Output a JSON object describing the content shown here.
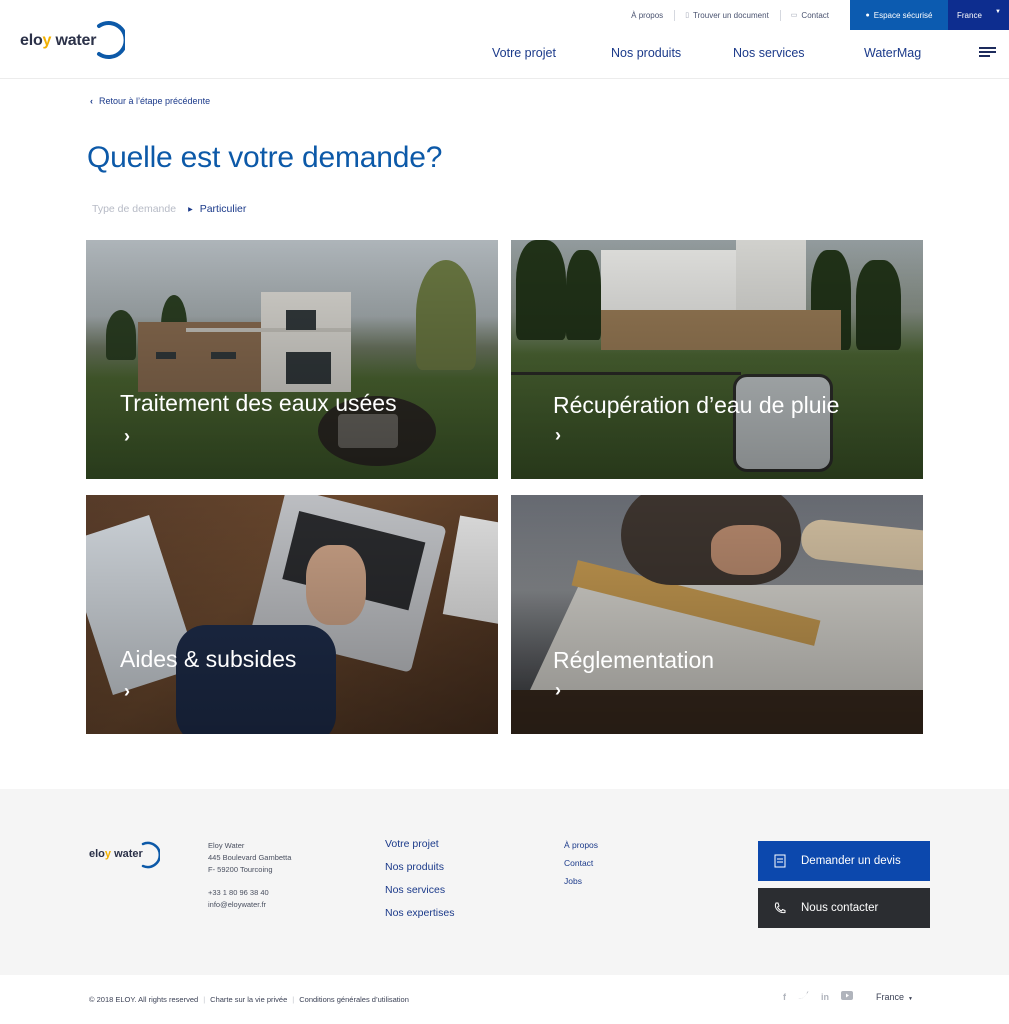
{
  "brand": {
    "name_part1": "elo",
    "name_accent": "y",
    "name_part2": " water",
    "accent_color": "#f2b000",
    "primary_color": "#0c59a8",
    "dark_blue": "#0d2d8f"
  },
  "topbar": {
    "about": "À propos",
    "find_document": "Trouver un document",
    "contact": "Contact",
    "secure_space": "Espace sécurisé",
    "language": "France"
  },
  "nav": {
    "items": [
      "Votre projet",
      "Nos produits",
      "Nos services",
      "WaterMag"
    ],
    "menu_icon": "hamburger-icon"
  },
  "back_link": "Retour à l’étape précédente",
  "page_title": "Quelle est votre demande?",
  "breadcrumb": {
    "step1": "Type de demande",
    "step2": "Particulier"
  },
  "tiles": [
    {
      "label": "Traitement des eaux usées"
    },
    {
      "label": "Récupération d’eau de pluie"
    },
    {
      "label": "Aides & subsides"
    },
    {
      "label": "Réglementation"
    }
  ],
  "footer": {
    "address": {
      "company": "Eloy Water",
      "street": "445 Boulevard Gambetta",
      "city": "F- 59200 Tourcoing",
      "phone": "+33 1 80 96 38 40",
      "email": "info@eloywater.fr"
    },
    "col1": [
      "Votre projet",
      "Nos produits",
      "Nos services",
      "Nos expertises"
    ],
    "col2": [
      "À propos",
      "Contact",
      "Jobs"
    ],
    "cta_quote": "Demander un devis",
    "cta_contact": "Nous contacter"
  },
  "legal": {
    "copyright": "© 2018 ELOY. All rights reserved",
    "privacy": "Charte sur la vie privée",
    "terms": "Conditions générales d’utilisation"
  },
  "social_icons": [
    "facebook-icon",
    "twitter-icon",
    "linkedin-icon",
    "youtube-icon"
  ],
  "footer_language": "France"
}
